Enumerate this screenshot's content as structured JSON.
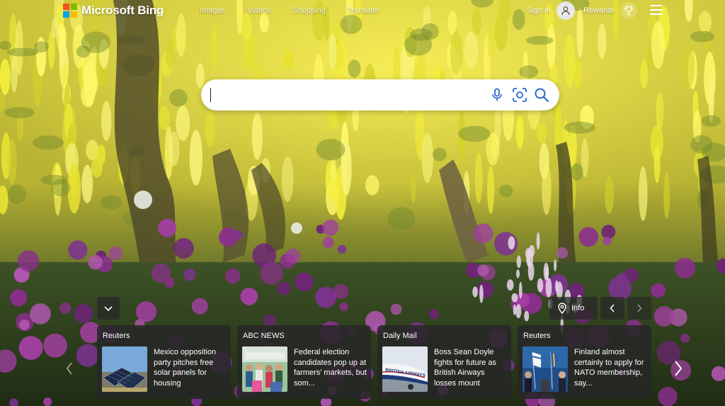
{
  "header": {
    "brand": "Microsoft Bing",
    "brand_colors": [
      "#f25022",
      "#7fba00",
      "#00a4ef",
      "#ffb900"
    ],
    "nav": [
      {
        "label": "Images"
      },
      {
        "label": "Videos"
      },
      {
        "label": "Shopping"
      },
      {
        "label": "Translate"
      }
    ],
    "signin_label": "Sign in",
    "rewards_label": "Rewards",
    "icons": {
      "avatar": "user-icon",
      "rewards": "trophy-icon",
      "menu": "hamburger-menu-icon"
    }
  },
  "search": {
    "value": "",
    "placeholder": "",
    "icons": [
      "microphone-icon",
      "visual-search-icon",
      "search-icon"
    ]
  },
  "controls": {
    "info_label": "Info",
    "icons": [
      "chevron-down-icon",
      "location-pin-icon",
      "chevron-left-icon",
      "chevron-right-icon"
    ]
  },
  "news": [
    {
      "source": "Reuters",
      "title": "Mexico opposition party pitches free solar panels for housing",
      "thumb": "solar-panels-image"
    },
    {
      "source": "ABC NEWS",
      "title": "Federal election candidates pop up at farmers' markets, but som...",
      "thumb": "crowd-image"
    },
    {
      "source": "Daily Mail",
      "title": "Boss Sean Doyle fights for future as British Airways losses mount",
      "thumb": "british-airways-plane-image"
    },
    {
      "source": "Reuters",
      "title": "Finland almost certainly to apply for NATO membership, say...",
      "thumb": "press-conference-image"
    }
  ],
  "thumb_text": {
    "plane_livery": "BRITISH AIRWAYS"
  }
}
